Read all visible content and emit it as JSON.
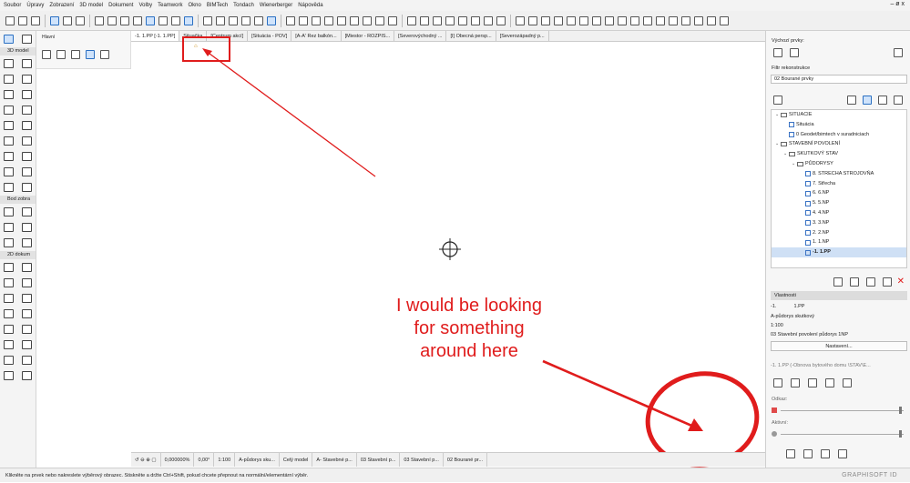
{
  "menu": [
    "Soubor",
    "Úpravy",
    "Zobrazení",
    "3D model",
    "Dokument",
    "Volby",
    "Teamwork",
    "Okno",
    "BIMTech",
    "Tondach",
    "Wienerberger",
    "Nápověda"
  ],
  "window_controls": "– ø x",
  "toolbox": {
    "sections": [
      {
        "label": "3D model"
      },
      {
        "label": "Bod zobra"
      },
      {
        "label": "2D dokum"
      }
    ]
  },
  "info_box": {
    "label": "Hlavní"
  },
  "tabs": [
    {
      "label": "-1. 1.PP [-1. 1.PP]"
    },
    {
      "label": "Situačka"
    },
    {
      "label": "[Centrum akcí]"
    },
    {
      "label": "[Situácia - POV]"
    },
    {
      "label": "[A-A' Rez balkón..."
    },
    {
      "label": "[Miestor - ROZPIS..."
    },
    {
      "label": "[Severovýchodný ..."
    },
    {
      "label": "[I] Obecná persp..."
    },
    {
      "label": "[Severozápadný p..."
    }
  ],
  "canvas": {
    "annotation_text": [
      "I would be looking",
      "for something",
      "around here"
    ],
    "highlight_color": "#e01c1c"
  },
  "bottom_bar": {
    "zoom": "0,000000%",
    "angle": "0,00°",
    "scale": "1:100",
    "layer_combo": "A-půdorys sku...",
    "model_view": "Celý model",
    "pen_set": "A- Stavebné p...",
    "mvo": "03 Stavební p...",
    "mvo2": "03 Stavební p...",
    "renovation": "02 Bourané pr..."
  },
  "status": {
    "message": "Klikněte na prvek nebo nakreslete výběrový obrazec. Stiskněte a držte Ctrl+Shift, pokud chcete přepnout na normální/elementární výběr.",
    "brand": "GRAPHISOFT ID"
  },
  "right_panel": {
    "default_label": "Výchozí prvky:",
    "renovation_filter_label": "Filtr rekonstrukce",
    "renovation_filter_value": "02 Bourané prvky",
    "tree": [
      {
        "label": "SITUACIE",
        "level": 0,
        "type": "folder"
      },
      {
        "label": "Situácia",
        "level": 1,
        "type": "sheet"
      },
      {
        "label": "0 Geodet/bimtech v suradniciach",
        "level": 1,
        "type": "sheet"
      },
      {
        "label": "STAVEBNÍ POVOLENÍ",
        "level": 0,
        "type": "folder"
      },
      {
        "label": "SKUTKOVÝ STAV",
        "level": 1,
        "type": "folder"
      },
      {
        "label": "PŮDORYSY",
        "level": 2,
        "type": "folder"
      },
      {
        "label": "8. STRECHA STROJOVŇA",
        "level": 3,
        "type": "sheet"
      },
      {
        "label": "7. Střecha",
        "level": 3,
        "type": "sheet"
      },
      {
        "label": "6. 6.NP",
        "level": 3,
        "type": "sheet"
      },
      {
        "label": "5. 5.NP",
        "level": 3,
        "type": "sheet"
      },
      {
        "label": "4. 4.NP",
        "level": 3,
        "type": "sheet"
      },
      {
        "label": "3. 3.NP",
        "level": 3,
        "type": "sheet"
      },
      {
        "label": "2. 2.NP",
        "level": 3,
        "type": "sheet"
      },
      {
        "label": "1. 1.NP",
        "level": 3,
        "type": "sheet"
      },
      {
        "label": "-1. 1.PP",
        "level": 3,
        "type": "sheet",
        "selected": true
      }
    ],
    "properties": {
      "header": "Vlastnosti",
      "id": "-1.",
      "name": "1.PP",
      "layer_combo": "A-půdorys skutkový",
      "scale": "1:100",
      "mvo": "03 Stavební povolení půdorys 1NP",
      "settings_button": "Nastavení..."
    },
    "path_text": "-1. 1.PP (-Obnova bytového domu \\STAV\\E...",
    "link_label": "Odkaz:",
    "active_label": "Aktivní:"
  }
}
